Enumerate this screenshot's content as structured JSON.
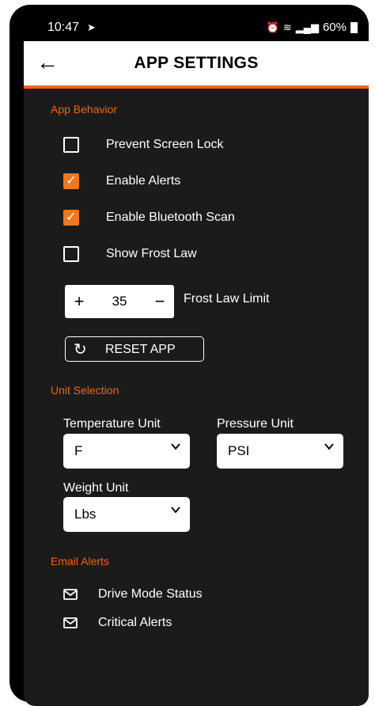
{
  "status_bar": {
    "time": "10:47",
    "battery": "60%"
  },
  "header": {
    "title": "APP SETTINGS"
  },
  "colors": {
    "accent": "#e9661c",
    "background": "#1b1b1b"
  },
  "app_behavior": {
    "title": "App Behavior",
    "options": [
      {
        "label": "Prevent Screen Lock",
        "checked": false
      },
      {
        "label": "Enable Alerts",
        "checked": true
      },
      {
        "label": "Enable Bluetooth Scan",
        "checked": true
      },
      {
        "label": "Show Frost Law",
        "checked": false
      }
    ],
    "frost_law_limit": {
      "value": "35",
      "label": "Frost Law Limit",
      "plus": "+",
      "minus": "−"
    },
    "reset_label": "RESET APP"
  },
  "unit_selection": {
    "title": "Unit Selection",
    "temperature": {
      "label": "Temperature Unit",
      "value": "F"
    },
    "pressure": {
      "label": "Pressure Unit",
      "value": "PSI"
    },
    "weight": {
      "label": "Weight Unit",
      "value": "Lbs"
    }
  },
  "email_alerts": {
    "title": "Email Alerts",
    "items": [
      "Drive Mode Status",
      "Critical Alerts"
    ]
  }
}
